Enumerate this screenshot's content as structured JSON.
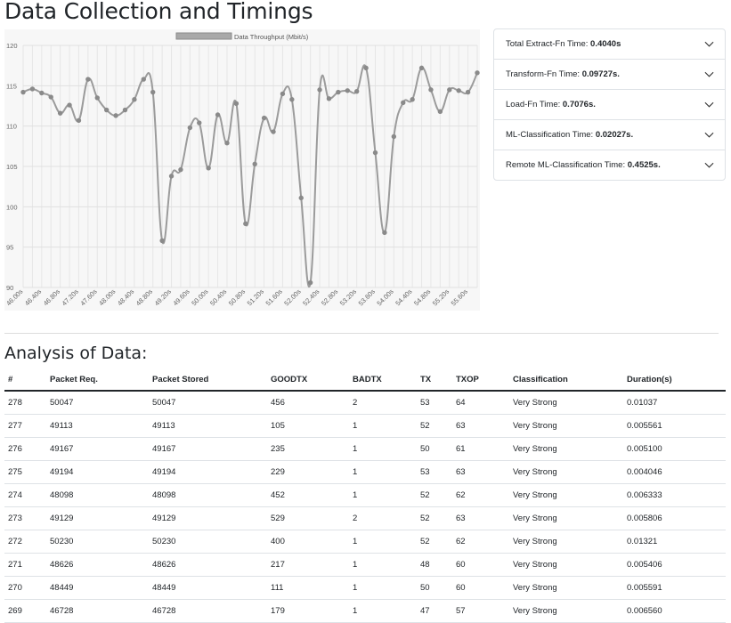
{
  "page": {
    "title": "Data Collection and Timings"
  },
  "chart_data": {
    "type": "line",
    "legend": "Data Throughput (Mbit/s)",
    "ylim": [
      90,
      120
    ],
    "yticks": [
      90,
      95,
      100,
      105,
      110,
      115,
      120
    ],
    "grid": true,
    "legend_position": "top",
    "color": "#9b9b9b",
    "x_tick_labels": [
      "46.00s",
      "46.40s",
      "46.80s",
      "47.20s",
      "47.60s",
      "48.00s",
      "48.40s",
      "48.80s",
      "49.20s",
      "49.60s",
      "50.00s",
      "50.40s",
      "50.80s",
      "51.20s",
      "51.60s",
      "52.00s",
      "52.40s",
      "52.80s",
      "53.20s",
      "53.60s",
      "54.00s",
      "54.40s",
      "54.80s",
      "55.20s",
      "55.60s"
    ],
    "x": [
      46.0,
      46.2,
      46.4,
      46.6,
      46.8,
      47.0,
      47.2,
      47.4,
      47.6,
      47.8,
      48.0,
      48.2,
      48.4,
      48.6,
      48.8,
      49.0,
      49.2,
      49.4,
      49.6,
      49.8,
      50.0,
      50.2,
      50.4,
      50.6,
      50.8,
      51.0,
      51.2,
      51.4,
      51.6,
      51.8,
      52.0,
      52.2,
      52.4,
      52.6,
      52.8,
      53.0,
      53.2,
      53.4,
      53.6,
      53.8,
      54.0,
      54.2,
      54.4,
      54.6,
      54.8,
      55.0,
      55.2,
      55.4,
      55.6,
      55.8
    ],
    "y": [
      114.2,
      114.6,
      114.1,
      113.6,
      111.6,
      112.6,
      110.7,
      115.8,
      113.5,
      112.0,
      111.3,
      112.0,
      113.3,
      115.8,
      114.2,
      95.8,
      103.8,
      104.6,
      109.8,
      110.4,
      104.8,
      111.4,
      107.9,
      112.8,
      97.9,
      105.3,
      111.0,
      109.3,
      114.0,
      113.3,
      101.1,
      90.6,
      114.5,
      113.4,
      114.2,
      114.4,
      114.3,
      117.2,
      106.7,
      96.8,
      108.7,
      112.9,
      113.3,
      117.2,
      114.5,
      111.8,
      114.5,
      114.4,
      114.2,
      116.6
    ]
  },
  "timings": [
    {
      "label": "Total Extract-Fn Time: ",
      "value": "0.4040s"
    },
    {
      "label": "Transform-Fn Time: ",
      "value": "0.09727s."
    },
    {
      "label": "Load-Fn Time: ",
      "value": "0.7076s."
    },
    {
      "label": "ML-Classification Time: ",
      "value": "0.02027s."
    },
    {
      "label": "Remote ML-Classification Time: ",
      "value": "0.4525s."
    }
  ],
  "analysis": {
    "title": "Analysis of Data:",
    "columns": [
      "#",
      "Packet Req.",
      "Packet Stored",
      "GOODTX",
      "BADTX",
      "TX",
      "TXOP",
      "Classification",
      "Duration(s)"
    ],
    "rows": [
      [
        "278",
        "50047",
        "50047",
        "456",
        "2",
        "53",
        "64",
        "Very Strong",
        "0.01037"
      ],
      [
        "277",
        "49113",
        "49113",
        "105",
        "1",
        "52",
        "63",
        "Very Strong",
        "0.005561"
      ],
      [
        "276",
        "49167",
        "49167",
        "235",
        "1",
        "50",
        "61",
        "Very Strong",
        "0.005100"
      ],
      [
        "275",
        "49194",
        "49194",
        "229",
        "1",
        "53",
        "63",
        "Very Strong",
        "0.004046"
      ],
      [
        "274",
        "48098",
        "48098",
        "452",
        "1",
        "52",
        "62",
        "Very Strong",
        "0.006333"
      ],
      [
        "273",
        "49129",
        "49129",
        "529",
        "2",
        "52",
        "63",
        "Very Strong",
        "0.005806"
      ],
      [
        "272",
        "50230",
        "50230",
        "400",
        "1",
        "52",
        "62",
        "Very Strong",
        "0.01321"
      ],
      [
        "271",
        "48626",
        "48626",
        "217",
        "1",
        "48",
        "60",
        "Very Strong",
        "0.005406"
      ],
      [
        "270",
        "48449",
        "48449",
        "111",
        "1",
        "50",
        "60",
        "Very Strong",
        "0.005591"
      ],
      [
        "269",
        "46728",
        "46728",
        "179",
        "1",
        "47",
        "57",
        "Very Strong",
        "0.006560"
      ]
    ]
  }
}
